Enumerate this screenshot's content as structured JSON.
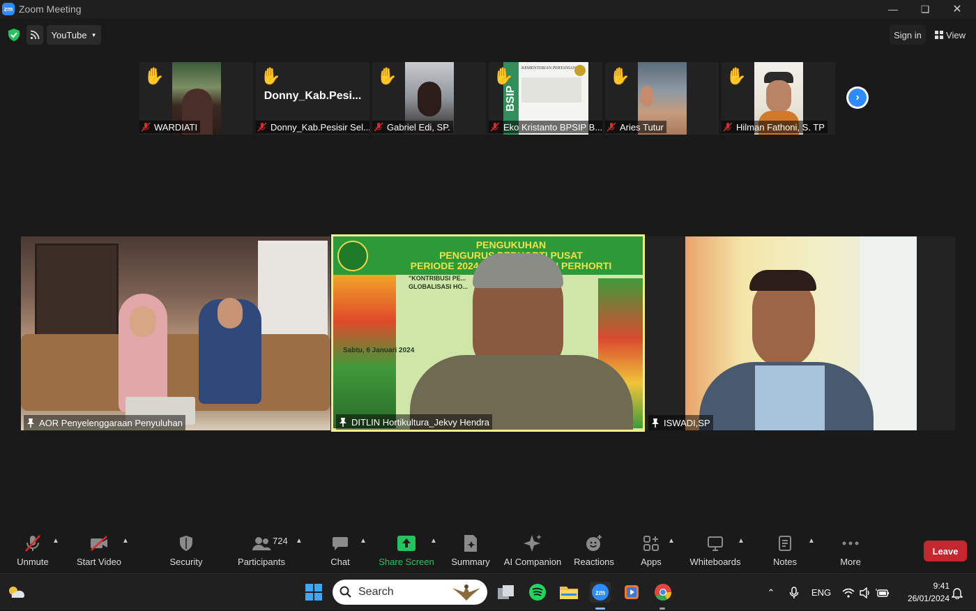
{
  "window": {
    "app_icon": "zm",
    "title": "Zoom Meeting"
  },
  "topbar": {
    "youtube_label": "YouTube",
    "sign_in": "Sign in",
    "view": "View"
  },
  "thumbnails": [
    {
      "name": "WARDIATI",
      "muted": true,
      "hand_raised": true
    },
    {
      "name": "Donny_Kab.Pesisir Sel...",
      "display_name": "Donny_Kab.Pesi...",
      "muted": true,
      "hand_raised": true
    },
    {
      "name": "Gabriel Edi,  SP.",
      "muted": true,
      "hand_raised": true
    },
    {
      "name": "Eko Kristanto BPSIP B...",
      "muted": true,
      "hand_raised": true
    },
    {
      "name": "Aries Tutur",
      "muted": true,
      "hand_raised": true
    },
    {
      "name": "Hilman Fathoni, S. TP",
      "muted": true,
      "hand_raised": true
    }
  ],
  "tiles": [
    {
      "name": "AOR Penyelenggaraan Penyuluhan"
    },
    {
      "name": "DITLIN Hortikultura_Jekvy Hendra",
      "active_speaker": true,
      "slide": {
        "line1": "PENGUKUHAN",
        "line2": "PENGURUS PERHORTI PUSAT",
        "line3": "PERIODE 2024-2027 D... SEHAN PERHORTI",
        "sub1": "\"KONTRIBUSI PE...",
        "sub2": "GLOBALISASI HO...",
        "date": "Sabtu, 6 Januari 2024"
      }
    },
    {
      "name": "ISWADI,SP"
    }
  ],
  "eko_card": {
    "header": "KEMENTERIAN PERTANIAN",
    "logo_text": "BSIP"
  },
  "toolbar": {
    "unmute": "Unmute",
    "start_video": "Start Video",
    "security": "Security",
    "participants": "Participants",
    "participants_count": "724",
    "chat": "Chat",
    "share_screen": "Share Screen",
    "summary": "Summary",
    "ai_companion": "AI Companion",
    "reactions": "Reactions",
    "apps": "Apps",
    "whiteboards": "Whiteboards",
    "notes": "Notes",
    "more": "More",
    "leave": "Leave"
  },
  "taskbar": {
    "search_placeholder": "Search",
    "lang": "ENG",
    "time": "9:41",
    "date": "26/01/2024"
  },
  "colors": {
    "accent": "#2d8cff",
    "leave": "#c4272d",
    "share_green": "#23c45e",
    "active_border": "#f2ef8c",
    "muted_red": "#e02828",
    "hand_yellow": "#f5c518"
  }
}
